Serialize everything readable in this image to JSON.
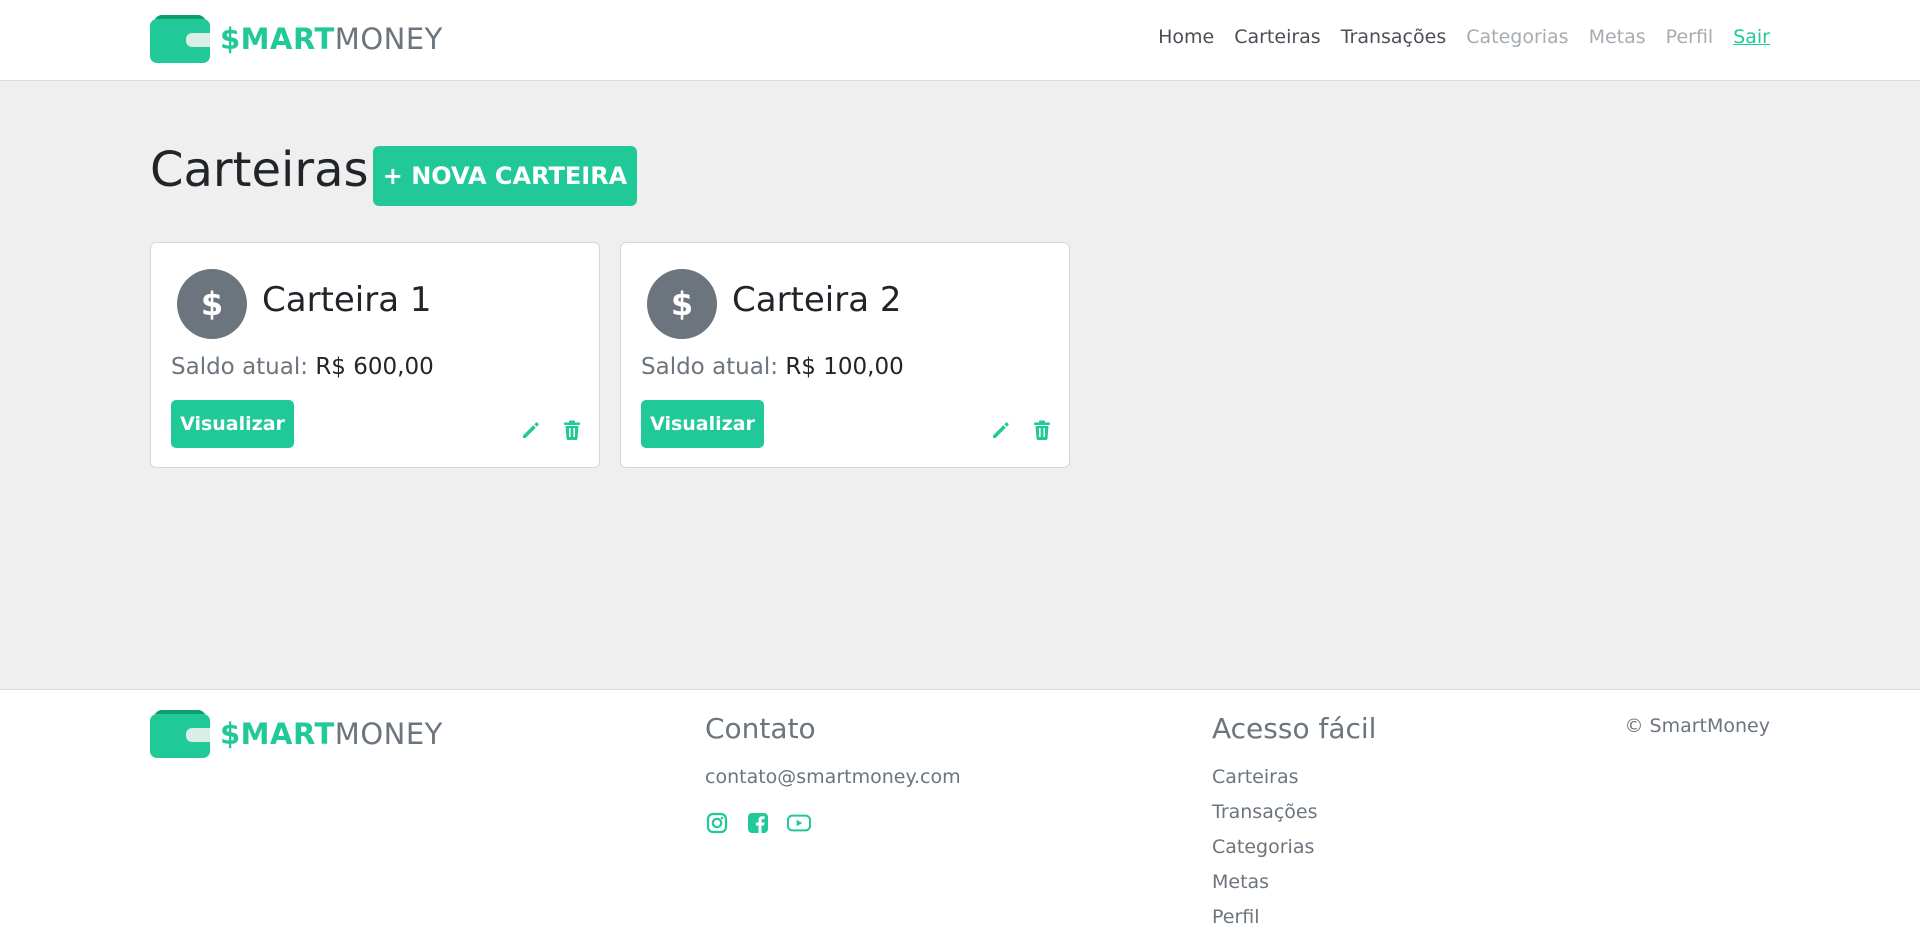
{
  "header": {
    "logo": {
      "prefix": "$MART",
      "suffix": "MONEY"
    },
    "nav": [
      {
        "label": "Home",
        "state": "normal"
      },
      {
        "label": "Carteiras",
        "state": "normal"
      },
      {
        "label": "Transações",
        "state": "normal"
      },
      {
        "label": "Categorias",
        "state": "muted"
      },
      {
        "label": "Metas",
        "state": "muted"
      },
      {
        "label": "Perfil",
        "state": "muted"
      },
      {
        "label": "Sair",
        "state": "accent"
      }
    ]
  },
  "main": {
    "title": "Carteiras",
    "new_button": "+ NOVA CARTEIRA",
    "wallets": [
      {
        "icon_symbol": "$",
        "name": "Carteira 1",
        "balance_label": "Saldo atual:",
        "balance": "R$ 600,00",
        "view_label": "Visualizar"
      },
      {
        "icon_symbol": "$",
        "name": "Carteira 2",
        "balance_label": "Saldo atual:",
        "balance": "R$ 100,00",
        "view_label": "Visualizar"
      }
    ]
  },
  "footer": {
    "logo": {
      "prefix": "$MART",
      "suffix": "MONEY"
    },
    "contact_heading": "Contato",
    "email": "contato@smartmoney.com",
    "socials": [
      "instagram-icon",
      "facebook-icon",
      "youtube-icon"
    ],
    "quick_heading": "Acesso fácil",
    "quick_links": [
      "Carteiras",
      "Transações",
      "Categorias",
      "Metas",
      "Perfil"
    ],
    "copyright": "© SmartMoney"
  },
  "colors": {
    "accent": "#20c997",
    "accent_dark": "#0e9e6b",
    "muted": "#6c757d",
    "background": "#efefef"
  }
}
